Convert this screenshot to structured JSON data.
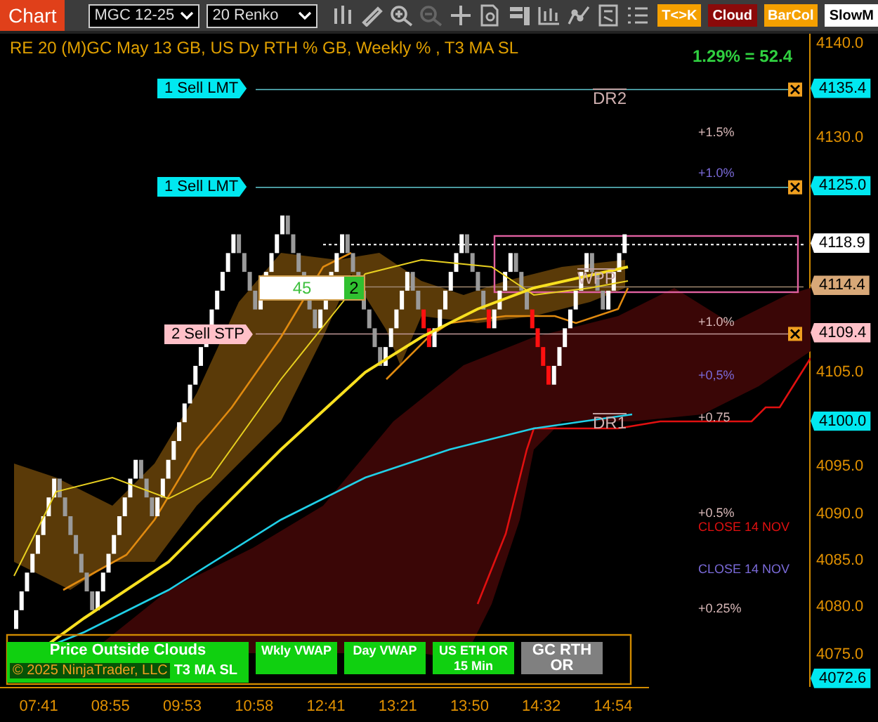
{
  "toolbar": {
    "title": "Chart",
    "instrument": "MGC 12-25",
    "bar_type": "20 Renko",
    "tools": [
      {
        "kind": "bars",
        "disabled": false
      },
      {
        "kind": "pencil",
        "disabled": false
      },
      {
        "kind": "zoom-in",
        "disabled": false
      },
      {
        "kind": "zoom-out",
        "disabled": true
      },
      {
        "kind": "crosshair",
        "disabled": false
      },
      {
        "kind": "data-box",
        "disabled": false
      },
      {
        "kind": "panels",
        "disabled": false
      },
      {
        "kind": "strategy",
        "disabled": false
      },
      {
        "kind": "indicator",
        "disabled": false
      },
      {
        "kind": "template",
        "disabled": false
      },
      {
        "kind": "list",
        "disabled": false
      }
    ],
    "toggles": [
      {
        "label": "T<>K",
        "color": "#f5a000"
      },
      {
        "label": "Cloud",
        "color": "#8b0a0a"
      },
      {
        "label": "BarCol",
        "color": "#f5a000"
      },
      {
        "label": "SlowM",
        "color": "#ffffff"
      }
    ]
  },
  "chart": {
    "legend": "RE 20  (M)GC May 13 GB, US Dy RTH % GB, Weekly % , T3 MA SL",
    "readout": "1.29% = 52.4",
    "order_tags": [
      {
        "label": "1 Sell LMT",
        "kind": "limit"
      },
      {
        "label": "1 Sell LMT",
        "kind": "limit"
      },
      {
        "label": "2 Sell STP",
        "kind": "stop"
      }
    ],
    "position": {
      "quantity": "45",
      "count": "2"
    },
    "levels": [
      {
        "text": "DR2"
      },
      {
        "text": "WPP"
      },
      {
        "text": "DR1"
      }
    ],
    "annotations": [
      {
        "text": "+1.5%",
        "color": "#d8b8b8"
      },
      {
        "text": "+1.0%",
        "color": "#7a6ad8"
      },
      {
        "text": "+1.0%",
        "color": "#d8b8b8"
      },
      {
        "text": "+0,5%",
        "color": "#7a6ad8"
      },
      {
        "text": "+0.75",
        "color": "#d8b8b8"
      },
      {
        "text": "+0.5%",
        "color": "#d8b8b8"
      },
      {
        "text": "CLOSE 14 NOV",
        "color": "#e01010"
      },
      {
        "text": "CLOSE 14 NOV",
        "color": "#7a6ad8"
      },
      {
        "text": "+0.25%",
        "color": "#d8b8b8"
      }
    ],
    "buttons": [
      {
        "label": "Price Outside Clouds",
        "sub": "T3 MA SL",
        "on": true
      },
      {
        "label": "Wkly VWAP",
        "on": true
      },
      {
        "label": "Day VWAP",
        "on": true
      },
      {
        "label": "US ETH OR 15 Min",
        "on": true
      },
      {
        "label": "GC RTH OR",
        "on": false
      }
    ],
    "copyright": "© 2025 NinjaTrader, LLC"
  },
  "price_axis": [
    {
      "text": "4140.0",
      "kind": "tick"
    },
    {
      "text": "4135.4",
      "kind": "flag",
      "color": "#00e8f0"
    },
    {
      "text": "4130.0",
      "kind": "tick"
    },
    {
      "text": "4125.0",
      "kind": "flag",
      "color": "#00e8f0"
    },
    {
      "text": "4118.9",
      "kind": "flag",
      "color": "#ffffff"
    },
    {
      "text": "4114.4",
      "kind": "flag",
      "color": "#d8a878"
    },
    {
      "text": "4109.4",
      "kind": "flag",
      "color": "#ffc0c8"
    },
    {
      "text": "4105.0",
      "kind": "tick"
    },
    {
      "text": "4100.0",
      "kind": "flag",
      "color": "#00e8f0"
    },
    {
      "text": "4095.0",
      "kind": "tick"
    },
    {
      "text": "4090.0",
      "kind": "tick"
    },
    {
      "text": "4085.0",
      "kind": "tick"
    },
    {
      "text": "4080.0",
      "kind": "tick"
    },
    {
      "text": "4075.0",
      "kind": "tick"
    },
    {
      "text": "4072.6",
      "kind": "flag",
      "color": "#00e8f0"
    }
  ],
  "time_axis": [
    "07:41",
    "08:55",
    "09:53",
    "10:58",
    "12:41",
    "13:21",
    "13:50",
    "14:32",
    "14:54"
  ]
}
